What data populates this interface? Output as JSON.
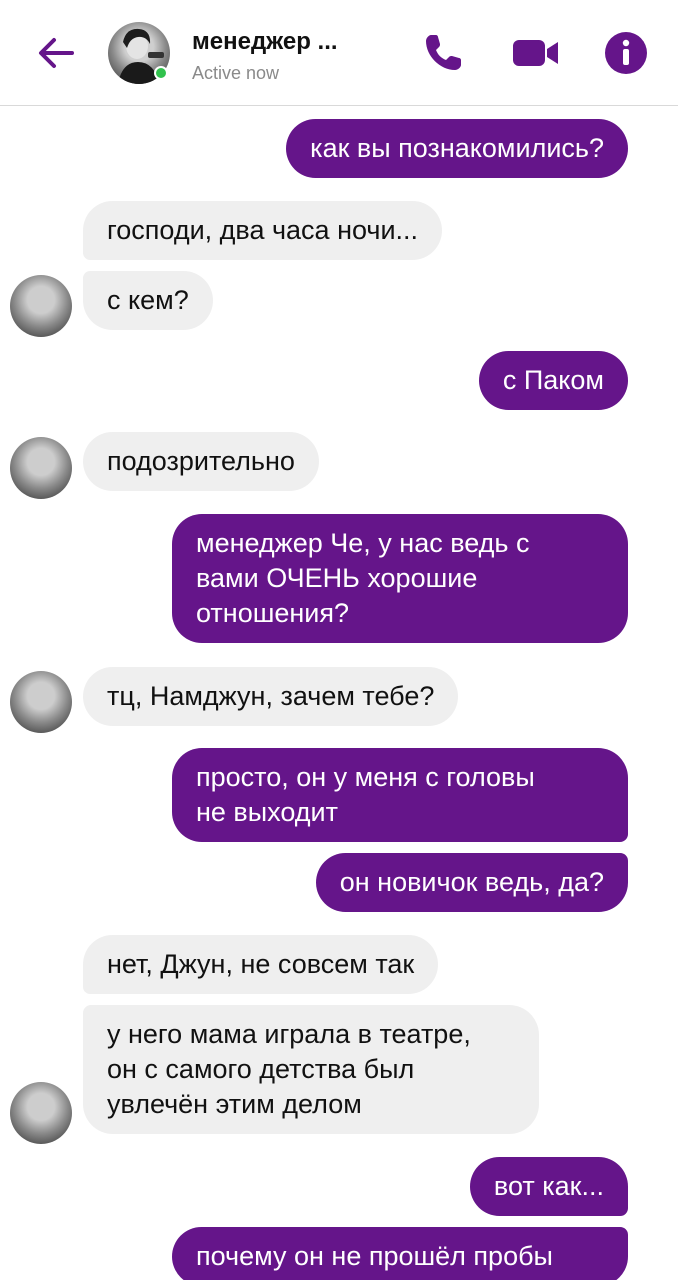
{
  "header": {
    "contact_name": "менеджер ...",
    "status": "Active now",
    "accent_color": "#65158a",
    "icons": [
      "back-arrow-icon",
      "phone-icon",
      "video-camera-icon",
      "info-icon"
    ]
  },
  "colors": {
    "outgoing_bubble": "#65158a",
    "incoming_bubble": "#efefef",
    "online_dot": "#31c24d"
  },
  "messages": [
    {
      "direction": "out",
      "text": "как вы познакомились?"
    },
    {
      "direction": "in",
      "text": "господи, два часа ночи..."
    },
    {
      "direction": "in",
      "text": "с кем?"
    },
    {
      "direction": "out",
      "text": "с Паком"
    },
    {
      "direction": "in",
      "text": "подозрительно"
    },
    {
      "direction": "out",
      "text": "менеджер Че, у нас ведь с\nвами ОЧЕНЬ хорошие\nотношения?"
    },
    {
      "direction": "in",
      "text": "тц, Намджун, зачем тебе?"
    },
    {
      "direction": "out",
      "text": "просто, он у меня с головы\nне выходит"
    },
    {
      "direction": "out",
      "text": "он новичок ведь, да?"
    },
    {
      "direction": "in",
      "text": "нет, Джун, не совсем так"
    },
    {
      "direction": "in",
      "text": "у него мама играла в театре,\nон с самого детства был\nувлечён этим делом"
    },
    {
      "direction": "out",
      "text": "вот как..."
    },
    {
      "direction": "out",
      "text": "почему он не прошёл пробы"
    }
  ]
}
